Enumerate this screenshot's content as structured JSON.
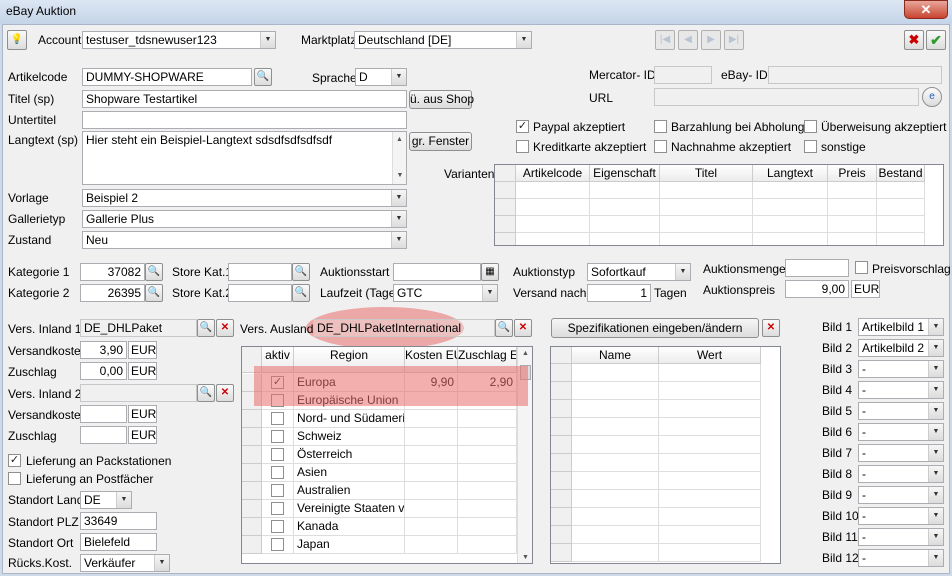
{
  "window": {
    "title": "eBay Auktion",
    "close": "✕"
  },
  "toolbar": {
    "account_label": "Account",
    "account_value": "testuser_tdsnewuser123",
    "marketplace_label": "Marktplatz",
    "marketplace_value": "Deutschland [DE]"
  },
  "left": {
    "artikelcode_label": "Artikelcode",
    "artikelcode": "DUMMY-SHOPWARE",
    "sprache_label": "Sprache",
    "sprache": "D",
    "titel_label": "Titel (sp)",
    "titel": "Shopware Testartikel",
    "aus_shop": "ü. aus Shop",
    "untertitel_label": "Untertitel",
    "langtext_label": "Langtext (sp)",
    "langtext": "Hier steht ein Beispiel-Langtext sdsdfsdfsdfsdf",
    "gr_fenster": "gr. Fenster",
    "vorlage_label": "Vorlage",
    "vorlage": "Beispiel 2",
    "gallerietyp_label": "Gallerietyp",
    "gallerietyp": "Gallerie Plus",
    "zustand_label": "Zustand",
    "zustand": "Neu"
  },
  "right_top": {
    "mercator_label": "Mercator- ID",
    "ebay_id_label": "eBay- ID",
    "url_label": "URL",
    "pay": [
      "Paypal akzeptiert",
      "Barzahlung bei Abholung",
      "Überweisung akzeptiert",
      "Kreditkarte akzeptiert",
      "Nachnahme akzeptiert",
      "sonstige"
    ],
    "pay_checked": [
      true,
      false,
      false,
      false,
      false,
      false
    ],
    "varianten_label": "Varianten",
    "varianten_cols": [
      "Artikelcode",
      "Eigenschaft",
      "Titel",
      "Langtext",
      "Preis",
      "Bestand"
    ]
  },
  "mid": {
    "kat1_label": "Kategorie 1",
    "kat1": "37082",
    "kat2_label": "Kategorie 2",
    "kat2": "26395",
    "store1_label": "Store Kat.1",
    "store2_label": "Store Kat.2",
    "start_label": "Auktionsstart",
    "laufzeit_label": "Laufzeit (Tage)",
    "laufzeit": "GTC",
    "typ_label": "Auktionstyp",
    "typ": "Sofortkauf",
    "versand_nach_label": "Versand nach",
    "versand_nach": "1",
    "tagen": "Tagen",
    "menge_label": "Auktionsmenge",
    "preisvorschlag": "Preisvorschlag",
    "preis_label": "Auktionspreis",
    "preis": "9,00",
    "currency": "EUR"
  },
  "shipping": {
    "inland1_label": "Vers. Inland 1",
    "inland1": "DE_DHLPaket",
    "kosten_label": "Versandkosten",
    "kosten1": "3,90",
    "zuschlag_label": "Zuschlag",
    "zuschlag1": "0,00",
    "eur": "EUR",
    "inland2_label": "Vers. Inland 2",
    "pack": "Lieferung an Packstationen",
    "post": "Lieferung an Postfächer",
    "land_label": "Standort Land",
    "land": "DE",
    "plz_label": "Standort PLZ",
    "plz": "33649",
    "ort_label": "Standort Ort",
    "ort": "Bielefeld",
    "rueck_label": "Rücks.Kost.",
    "rueck": "Verkäufer",
    "ausland_label": "Vers. Ausland",
    "ausland": "DE_DHLPaketInternational"
  },
  "regions": {
    "cols": [
      "aktiv",
      "Region",
      "Kosten EUR",
      "Zuschlag EUR"
    ],
    "rows": [
      {
        "name": "Europa",
        "kosten": "9,90",
        "zuschlag": "2,90",
        "checked": true
      },
      {
        "name": "Europäische Union",
        "kosten": "",
        "zuschlag": "",
        "checked": false
      },
      {
        "name": "Nord- und Südamerika",
        "kosten": "",
        "zuschlag": "",
        "checked": false
      },
      {
        "name": "Schweiz",
        "kosten": "",
        "zuschlag": "",
        "checked": false
      },
      {
        "name": "Österreich",
        "kosten": "",
        "zuschlag": "",
        "checked": false
      },
      {
        "name": "Asien",
        "kosten": "",
        "zuschlag": "",
        "checked": false
      },
      {
        "name": "Australien",
        "kosten": "",
        "zuschlag": "",
        "checked": false
      },
      {
        "name": "Vereinigte Staaten vo",
        "kosten": "",
        "zuschlag": "",
        "checked": false
      },
      {
        "name": "Kanada",
        "kosten": "",
        "zuschlag": "",
        "checked": false
      },
      {
        "name": "Japan",
        "kosten": "",
        "zuschlag": "",
        "checked": false
      }
    ]
  },
  "specs": {
    "button": "Spezifikationen eingeben/ändern",
    "cols": [
      "Name",
      "Wert"
    ]
  },
  "images": {
    "labels": [
      "Bild 1",
      "Bild 2",
      "Bild 3",
      "Bild 4",
      "Bild 5",
      "Bild 6",
      "Bild 7",
      "Bild 8",
      "Bild 9",
      "Bild 10",
      "Bild 11",
      "Bild 12"
    ],
    "values": [
      "Artikelbild 1",
      "Artikelbild 2",
      "-",
      "-",
      "-",
      "-",
      "-",
      "-",
      "-",
      "-",
      "-",
      "-"
    ]
  }
}
